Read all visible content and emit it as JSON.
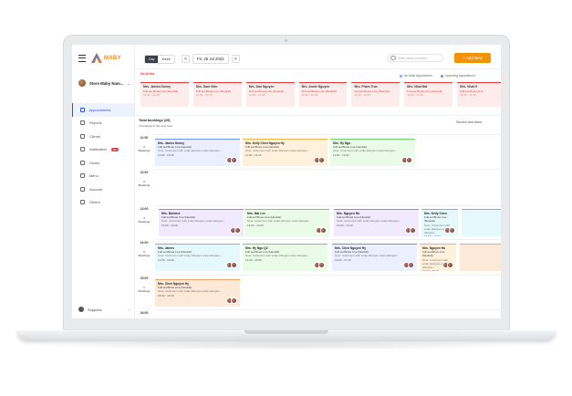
{
  "sidebar": {
    "brand": "MABY",
    "store": "Store Maby Nam... ",
    "items": [
      {
        "label": "Appointments",
        "active": true,
        "icon": "calendar-icon"
      },
      {
        "label": "Reports",
        "icon": "chart-icon"
      },
      {
        "label": "Clients",
        "icon": "users-icon"
      },
      {
        "label": "Notification",
        "badge": "99+",
        "icon": "bell-icon"
      },
      {
        "label": "Stores",
        "icon": "store-icon"
      },
      {
        "label": "Menu",
        "icon": "menu-icon"
      },
      {
        "label": "Account",
        "icon": "account-icon"
      },
      {
        "label": "Others",
        "icon": "grid-icon"
      }
    ],
    "support": "Supports"
  },
  "toolbar": {
    "day": "Day",
    "week": "Week",
    "prev": "<",
    "next": ">",
    "date": "Fri, 25 Jul 2022",
    "search_placeholder": "Enter phone to search",
    "add": "+  Add New"
  },
  "pending": {
    "title": "No Artist",
    "legend": [
      "No Artist Appointment",
      "Upcoming Appointment"
    ],
    "cards": [
      {
        "name": "Mrs. James Donny",
        "service": "Full set Bmax Live (Neutral)",
        "time": "11:00 - 11:40"
      },
      {
        "name": "Mrs. Dam Hiền",
        "service": "Full set Bmax Live (Neutral)",
        "time": "11:00 - 11:40"
      },
      {
        "name": "Mrs. Dan Nguyen",
        "service": "Full set Bmax Live (Neutral)",
        "time": "11:00 - 11:40"
      },
      {
        "name": "Mrs. Annie Nguyen",
        "service": "Full set Bmax Live (Neutral)",
        "time": "11:00 - 11:40"
      },
      {
        "name": "Mrs. Pham Tran",
        "service": "Full set Bmax Live (Neutral)",
        "time": "11:00 - 11:40"
      },
      {
        "name": "Mrs. Nhat Mai",
        "service": "Full set Bmax Live (Neutral)",
        "time": "11:00 - 11:40"
      },
      {
        "name": "Mrs. Nhat H",
        "service": "Full set Bmax Live",
        "time": "11:00 - 11:40"
      }
    ]
  },
  "bookings": {
    "title": "Total bookings (25)",
    "subtitle": "4 bookings in the next hour",
    "filter": "Service and Artist",
    "slots": [
      {
        "time": "11:00",
        "count": "3",
        "unit": "Bookings"
      },
      {
        "time": "12:00",
        "count": "0",
        "unit": "Bookings"
      },
      {
        "time": "13:00",
        "count": "4",
        "unit": "Bookings"
      },
      {
        "time": "14:00",
        "count": "5",
        "unit": "Bookings"
      },
      {
        "time": "15:00",
        "count": "1",
        "unit": "Bookings"
      },
      {
        "time": "16:00",
        "count": "",
        "unit": ""
      }
    ],
    "service": "Full set Bmax Live (Neutral)",
    "note": "Note: customers with scalp allergies scalp allergies...",
    "cards": [
      {
        "name": "Mrs. James Donny",
        "time": "11:00 - 13:40",
        "color": "blue"
      },
      {
        "name": "Mrs. Kelly Chen Nguyen Hy",
        "time": "11:00 - 12:10",
        "color": "orange"
      },
      {
        "name": "Mrs. Hy Ngo",
        "time": "11:00 - 12:00",
        "color": "green"
      },
      {
        "name": "Mrs. Mohend",
        "time": "13:00 - 14:00",
        "color": "purple"
      },
      {
        "name": "Mrs. Mai Lee",
        "time": "13:00 - 14:00",
        "color": "green"
      },
      {
        "name": "Mrs. Nguyen Ha",
        "time": "13:00 - 14:10",
        "color": "purple"
      },
      {
        "name": "Mrs. Kelly Chen",
        "time": "13:00 - 17:10",
        "color": "cyan"
      },
      {
        "name": "Mrs. James",
        "time": "14:00 - 14:40",
        "color": "cyan"
      },
      {
        "name": "Mrs. Hy Ngo Q2",
        "time": "14:00 - 15:00",
        "color": "green"
      },
      {
        "name": "Mrs. Chen Nguyen Hy",
        "time": "14:00 - 17:10",
        "color": "blue"
      },
      {
        "name": "Mrs. Nguyen Ha",
        "time": "14:00 - 15:10",
        "color": "orange"
      },
      {
        "name": "Mrs. Chen Nguyen Hy",
        "time": "15:00 - 16:10",
        "color": "peach"
      }
    ]
  },
  "colors": {
    "accent": "#f39200",
    "primary": "#2d4fd6",
    "alert": "#e53935"
  }
}
